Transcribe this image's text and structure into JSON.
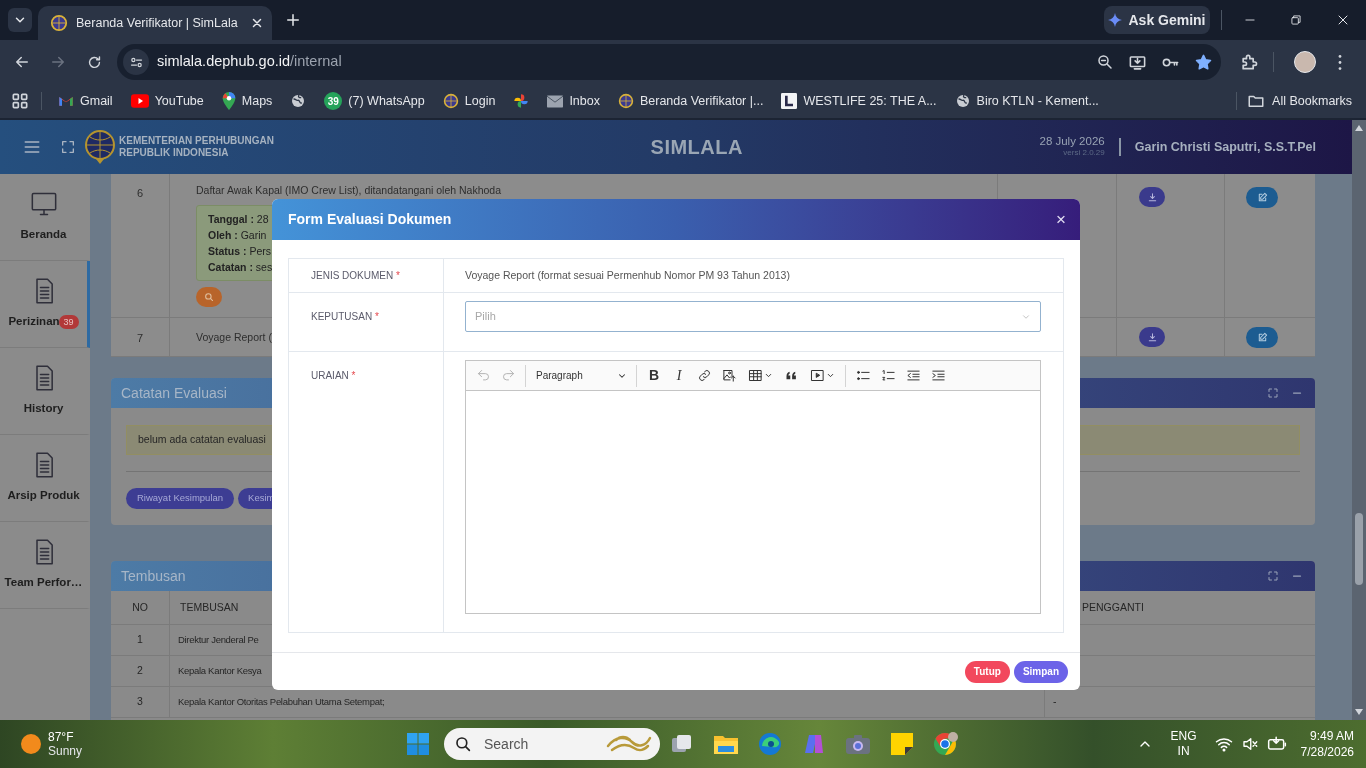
{
  "browser": {
    "tab": {
      "title": "Beranda Verifikator | SimLala"
    },
    "can_go_forward": false,
    "address": {
      "host": "simlala.dephub.go.id",
      "path": "/internal"
    },
    "bookmarked": true,
    "gemini": "Ask Gemini",
    "bookmarks": [
      {
        "kind": "gmail",
        "label": "Gmail"
      },
      {
        "kind": "youtube",
        "label": "YouTube"
      },
      {
        "kind": "maps",
        "label": "Maps"
      },
      {
        "kind": "globe"
      },
      {
        "kind": "whatsapp",
        "badge": "39",
        "label": "(7) WhatsApp"
      },
      {
        "kind": "emblem",
        "label": "Login"
      },
      {
        "kind": "pinwheel"
      },
      {
        "kind": "mail",
        "label": "Inbox"
      },
      {
        "kind": "emblem",
        "label": "Beranda Verifikator |..."
      },
      {
        "kind": "letter",
        "label": "WESTLIFE 25: THE A..."
      },
      {
        "kind": "globe",
        "label": "Biro KTLN - Kement..."
      }
    ],
    "all_bookmarks": "All Bookmarks"
  },
  "header": {
    "org": [
      "KEMENTERIAN PERHUBUNGAN",
      "REPUBLIK INDONESIA"
    ],
    "app": "SIMLALA",
    "date": "28 July 2026",
    "version": "versi 2.0.29",
    "user": "Garin Christi Saputri, S.S.T.Pel"
  },
  "sidebar": {
    "items": [
      {
        "label": "Beranda",
        "kind": "monitor",
        "selected": false
      },
      {
        "label": "Perizinan",
        "kind": "document",
        "badge": "39",
        "selected": true
      },
      {
        "label": "History",
        "kind": "document",
        "selected": false
      },
      {
        "label": "Arsip Produk",
        "kind": "document",
        "selected": false
      },
      {
        "label": "Team Perfor…",
        "kind": "document",
        "selected": false
      }
    ]
  },
  "documents": {
    "rows": [
      {
        "no": "6",
        "title": "Daftar Awak Kapal (IMO Crew List), ditandatangani oleh Nakhoda",
        "notes": [
          {
            "key": "Tanggal :",
            "value": "28"
          },
          {
            "key": "Oleh :",
            "value": "Garin"
          },
          {
            "key": "Status :",
            "value": "Pers"
          },
          {
            "key": "Catatan :",
            "value": "ses"
          }
        ]
      },
      {
        "no": "7",
        "title": "Voyage Report ("
      }
    ]
  },
  "evaluation_notes": {
    "title": "Catatan Evaluasi",
    "note": "belum ada catatan evaluasi",
    "buttons": [
      "Riwayat Kesimpulan",
      "Kesim"
    ]
  },
  "cc": {
    "title": "Tembusan",
    "columns": [
      "NO",
      "TEMBUSAN",
      "PENGGANTI"
    ],
    "rows": [
      {
        "no": "1",
        "name": "Direktur Jenderal Pe"
      },
      {
        "no": "2",
        "name": "Kepala Kantor Kesya"
      },
      {
        "no": "3",
        "name": "Kepala Kantor Otoritas Pelabuhan Utama Setempat;",
        "substitute": "-"
      }
    ]
  },
  "modal": {
    "title": "Form Evaluasi Dokumen",
    "close": "×",
    "fields": [
      {
        "kind": "text",
        "label": "JENIS DOKUMEN",
        "required_mark": "*",
        "value": "Voyage Report (format sesuai Permenhub Nomor PM 93 Tahun 2013)"
      },
      {
        "kind": "select",
        "label": "KEPUTUSAN",
        "required_mark": "*",
        "placeholder": "Pilih"
      },
      {
        "kind": "editor",
        "label": "URAIAN",
        "required_mark": "*",
        "toolbar": [
          {
            "kind": "undo",
            "disabled": true
          },
          {
            "kind": "redo",
            "disabled": true
          },
          {
            "kind": "divider"
          },
          {
            "kind": "heading",
            "label": "Paragraph",
            "disabled": false
          },
          {
            "kind": "divider"
          },
          {
            "kind": "bold",
            "glyph": "B",
            "disabled": false
          },
          {
            "kind": "italic",
            "glyph": "I",
            "disabled": false
          },
          {
            "kind": "link",
            "disabled": false
          },
          {
            "kind": "image",
            "disabled": false
          },
          {
            "kind": "table",
            "disabled": false
          },
          {
            "kind": "quote",
            "disabled": false
          },
          {
            "kind": "media",
            "disabled": false
          },
          {
            "kind": "divider"
          },
          {
            "kind": "bulleted",
            "disabled": false
          },
          {
            "kind": "numbered",
            "disabled": false
          },
          {
            "kind": "outdent",
            "disabled": false
          },
          {
            "kind": "indent",
            "disabled": false
          }
        ]
      }
    ],
    "buttons": [
      {
        "kind": "cancel",
        "label": "Tutup"
      },
      {
        "kind": "submit",
        "label": "Simpan"
      }
    ]
  },
  "taskbar": {
    "weather": {
      "temp": "87°F",
      "condition": "Sunny"
    },
    "search": "Search",
    "language": [
      "ENG",
      "IN"
    ],
    "time": "9:49 AM",
    "date": "7/28/2026"
  }
}
